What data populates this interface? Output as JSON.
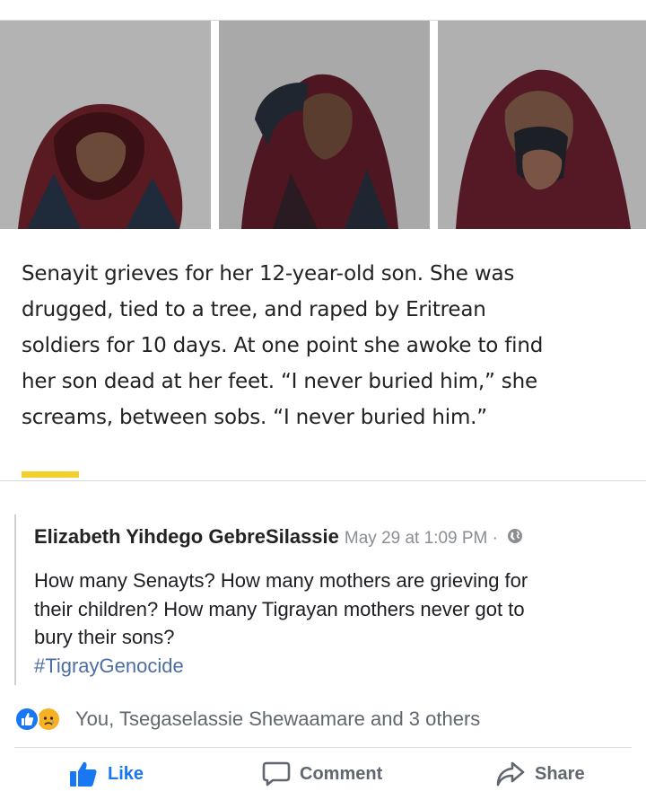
{
  "shared_post": {
    "photos": [
      {
        "name": "photo-woman-covered-head"
      },
      {
        "name": "photo-woman-arm-raised"
      },
      {
        "name": "photo-woman-covering-mouth"
      }
    ],
    "quote_lines": [
      "Senayit grieves for her 12-year-old son. She was",
      "drugged, tied to a tree, and raped by Eritrean",
      "soldiers for 10 days. At one point she awoke to find",
      "her son dead at her feet. “I never buried him,” she",
      "screams, between sobs. “I never buried him.”"
    ],
    "accent_color": "#f2cf2b"
  },
  "comment": {
    "author": "Elizabeth Yihdego GebreSilassie",
    "timestamp": "May 29 at 1:09 PM ·",
    "privacy_icon": "globe-icon",
    "body_lines": [
      "How many Senayts? How many mothers are grieving for",
      "their children? How many Tigrayan mothers never got to",
      "bury their sons?"
    ],
    "hashtag": "#TigrayGenocide"
  },
  "reactions": {
    "icons": [
      "like-reaction-icon",
      "sad-reaction-icon"
    ],
    "summary": "You, Tsegaselassie Shewaamare and 3 others"
  },
  "actions": {
    "like": "Like",
    "comment": "Comment",
    "share": "Share"
  },
  "colors": {
    "like_blue": "#1877f2",
    "hashtag_blue": "#4d6da6",
    "muted_gray": "#606770"
  }
}
